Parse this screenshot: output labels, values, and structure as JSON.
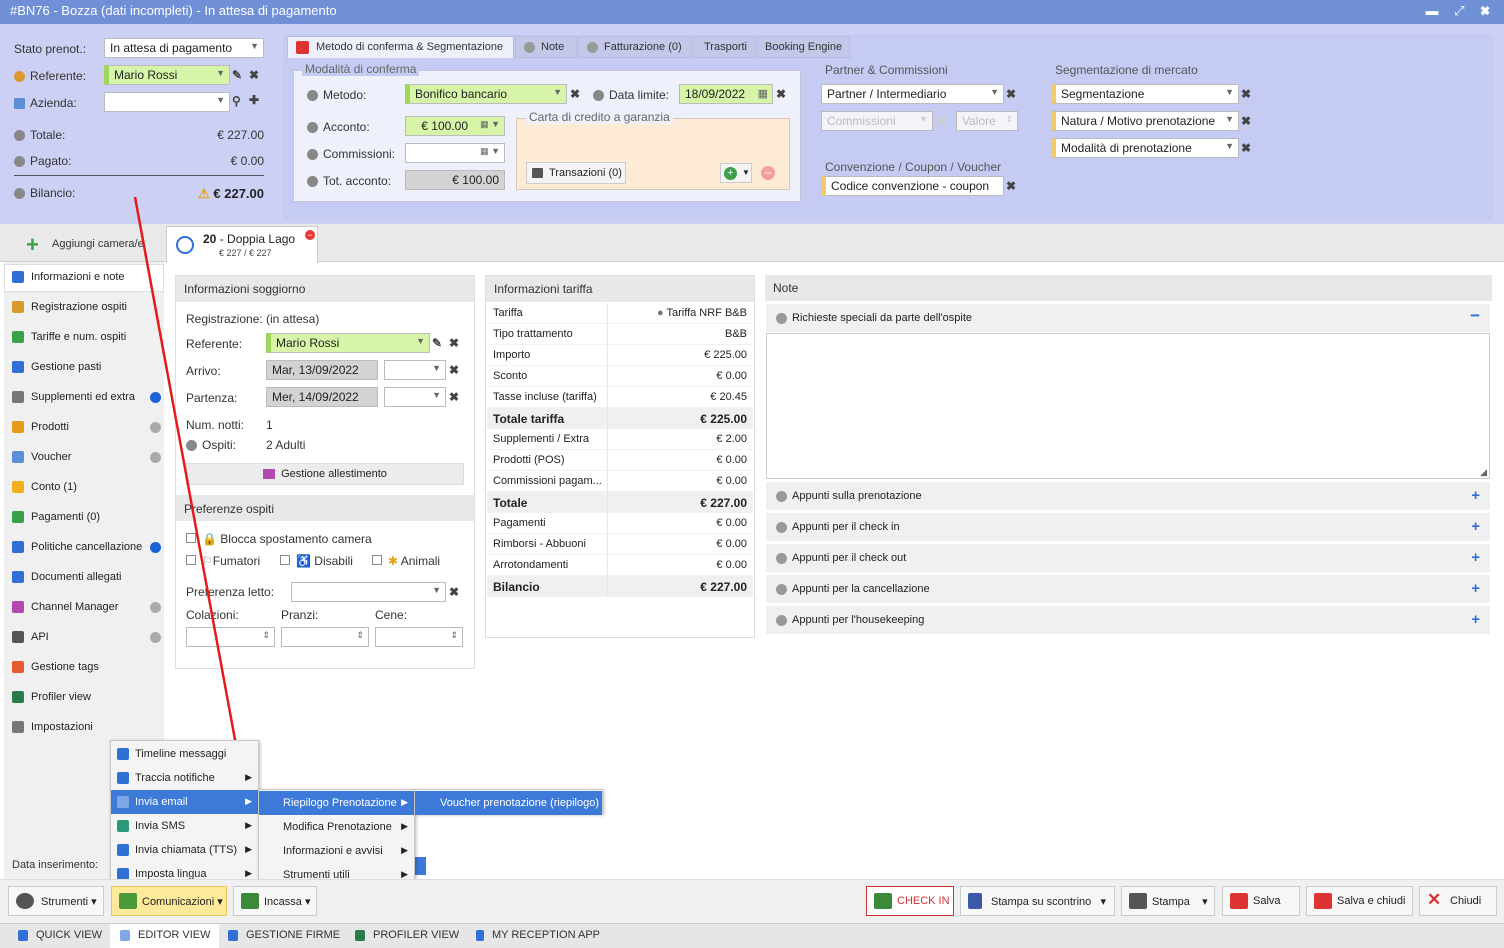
{
  "window": {
    "title": "#BN76 - Bozza (dati incompleti) - In attesa di pagamento",
    "controls": "▬ ⤢ ✖"
  },
  "left_summary": {
    "stato_label": "Stato prenot.:",
    "stato_value": "In attesa di pagamento",
    "referente_label": "Referente:",
    "referente_value": "Mario Rossi",
    "azienda_label": "Azienda:",
    "azienda_value": "",
    "totale_label": "Totale:",
    "totale_value": "€ 227.00",
    "pagato_label": "Pagato:",
    "pagato_value": "€ 0.00",
    "bilancio_label": "Bilancio:",
    "bilancio_value": "€ 227.00"
  },
  "top_tabs": [
    {
      "label": "Metodo di conferma & Segmentazione"
    },
    {
      "label": "Note"
    },
    {
      "label": "Fatturazione (0)"
    },
    {
      "label": "Trasporti"
    },
    {
      "label": "Booking Engine"
    }
  ],
  "conferma": {
    "title": "Modalità di conferma",
    "metodo_label": "Metodo:",
    "metodo_value": "Bonifico bancario",
    "data_label": "Data limite:",
    "data_value": "18/09/2022",
    "acconto_label": "Acconto:",
    "acconto_value": "€ 100.00",
    "commissioni_label": "Commissioni:",
    "commissioni_value": "",
    "tot_label": "Tot. acconto:",
    "tot_value": "€ 100.00",
    "carta_title": "Carta di credito a garanzia",
    "transazioni_label": "Transazioni (0)"
  },
  "partner": {
    "title": "Partner & Commissioni",
    "partner_value": "Partner / Intermediario",
    "commissioni_ph": "Commissioni",
    "valore_ph": "Valore",
    "conv_title": "Convenzione / Coupon / Voucher",
    "conv_value": "Codice convenzione - coupon"
  },
  "segmentazione": {
    "title": "Segmentazione di mercato",
    "items": [
      "Segmentazione",
      "Natura / Motivo prenotazione",
      "Modalità di prenotazione"
    ]
  },
  "room_tab": {
    "add_label": "Aggiungi camera/e",
    "number": "20",
    "name": "- Doppia Lago",
    "price": "€ 227 / € 227"
  },
  "nav": [
    {
      "label": "Informazioni e note",
      "color": "#2f6fd6"
    },
    {
      "label": "Registrazione ospiti",
      "color": "#d89a2f"
    },
    {
      "label": "Tariffe e num. ospiti",
      "color": "#3aa04a"
    },
    {
      "label": "Gestione pasti",
      "color": "#2f6fd6"
    },
    {
      "label": "Supplementi ed extra",
      "color": "#777"
    },
    {
      "label": "Prodotti",
      "color": "#e69a1c"
    },
    {
      "label": "Voucher",
      "color": "#5a8fd6"
    },
    {
      "label": "Conto (1)",
      "color": "#f0b21c"
    },
    {
      "label": "Pagamenti (0)",
      "color": "#3aa04a"
    },
    {
      "label": "Politiche cancellazione",
      "color": "#2f6fd6"
    },
    {
      "label": "Documenti allegati",
      "color": "#2f6fd6"
    },
    {
      "label": "Channel Manager",
      "color": "#b04ab0"
    },
    {
      "label": "API",
      "color": "#555"
    },
    {
      "label": "Gestione tags",
      "color": "#e65a2f"
    },
    {
      "label": "Profiler view",
      "color": "#2a7a4a"
    },
    {
      "label": "Impostazioni",
      "color": "#777"
    }
  ],
  "soggiorno": {
    "title": "Informazioni soggiorno",
    "reg_label": "Registrazione:",
    "reg_value": "(in attesa)",
    "ref_label": "Referente:",
    "ref_value": "Mario Rossi",
    "arrivo_label": "Arrivo:",
    "arrivo_value": "Mar, 13/09/2022",
    "partenza_label": "Partenza:",
    "partenza_value": "Mer, 14/09/2022",
    "notti_label": "Num. notti:",
    "notti_value": "1",
    "ospiti_label": "Ospiti:",
    "ospiti_value": "2 Adulti",
    "allestimento_label": "Gestione allestimento"
  },
  "preferenze": {
    "title": "Preferenze ospiti",
    "blocca": "Blocca spostamento camera",
    "fumatori": "Fumatori",
    "disabili": "Disabili",
    "animali": "Animali",
    "letto_label": "Preferenza letto:",
    "colazioni": "Colazioni:",
    "pranzi": "Pranzi:",
    "cene": "Cene:"
  },
  "tariffa": {
    "title": "Informazioni tariffa",
    "rows": [
      {
        "label": "Tariffa",
        "value": "Tariffa NRF B&B",
        "bold": false
      },
      {
        "label": "Tipo trattamento",
        "value": "B&B",
        "bold": false
      },
      {
        "label": "Importo",
        "value": "€ 225.00",
        "bold": false
      },
      {
        "label": "Sconto",
        "value": "€ 0.00",
        "bold": false
      },
      {
        "label": "Tasse incluse (tariffa)",
        "value": "€ 20.45",
        "bold": false
      },
      {
        "label": "Totale tariffa",
        "value": "€ 225.00",
        "bold": true
      },
      {
        "label": "Supplementi / Extra",
        "value": "€ 2.00",
        "bold": false
      },
      {
        "label": "Prodotti (POS)",
        "value": "€ 0.00",
        "bold": false
      },
      {
        "label": "Commissioni pagam...",
        "value": "€ 0.00",
        "bold": false
      },
      {
        "label": "Totale",
        "value": "€ 227.00",
        "bold": true
      },
      {
        "label": "Pagamenti",
        "value": "€ 0.00",
        "bold": false
      },
      {
        "label": "Rimborsi - Abbuoni",
        "value": "€ 0.00",
        "bold": false
      },
      {
        "label": "Arrotondamenti",
        "value": "€ 0.00",
        "bold": false
      },
      {
        "label": "Bilancio",
        "value": "€ 227.00",
        "bold": true
      }
    ]
  },
  "note": {
    "title": "Note",
    "first": "Richieste speciali da parte dell'ospite",
    "rows": [
      "Appunti sulla prenotazione",
      "Appunti per il check in",
      "Appunti per il check out",
      "Appunti per la cancellazione",
      "Appunti per l'housekeeping"
    ]
  },
  "menu1": [
    {
      "label": "Timeline messaggi",
      "arrow": false,
      "color": "#2f6fd6"
    },
    {
      "label": "Traccia notifiche",
      "arrow": true,
      "color": "#2f6fd6"
    },
    {
      "label": "Invia email",
      "arrow": true,
      "color": "#7fa6e6"
    },
    {
      "label": "Invia SMS",
      "arrow": true,
      "color": "#2a9a7a"
    },
    {
      "label": "Invia chiamata (TTS)",
      "arrow": true,
      "color": "#2f6fd6"
    },
    {
      "label": "Imposta lingua",
      "arrow": true,
      "color": "#2f6fd6"
    }
  ],
  "menu2": [
    {
      "label": "Riepilogo Prenotazione"
    },
    {
      "label": "Modifica Prenotazione"
    },
    {
      "label": "Informazioni e avvisi"
    },
    {
      "label": "Strumenti utili"
    }
  ],
  "menu3": [
    {
      "label": "Voucher prenotazione (riepilogo)"
    }
  ],
  "data_inserimento": "Data inserimento:",
  "toolbar": {
    "strumenti": "Strumenti",
    "comunicazioni": "Comunicazioni",
    "incassa": "Incassa",
    "checkin": "CHECK IN",
    "stampa_scontrino": "Stampa su scontrino",
    "stampa": "Stampa",
    "salva": "Salva",
    "salva_chiudi": "Salva e chiudi",
    "chiudi": "Chiudi"
  },
  "bottom": [
    "QUICK VIEW",
    "EDITOR VIEW",
    "GESTIONE FIRME",
    "PROFILER VIEW",
    "MY RECEPTION APP"
  ],
  "colors": {
    "accent": "#3d79d8",
    "green_field": "#d6f5a8",
    "header": "#6f8fd6"
  }
}
